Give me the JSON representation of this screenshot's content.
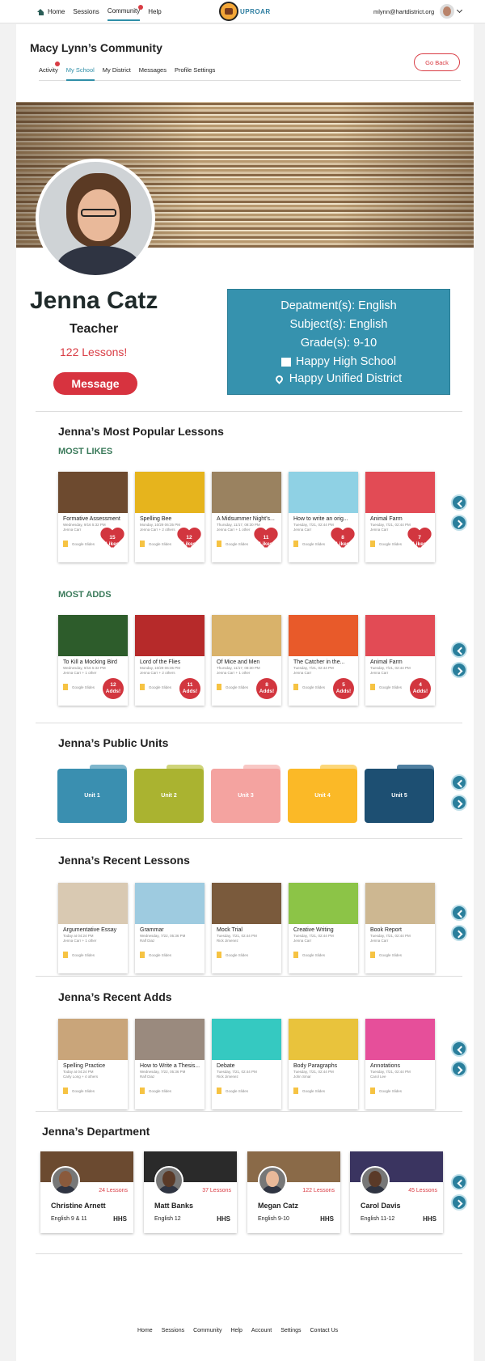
{
  "topnav": {
    "items": [
      "Home",
      "Sessions",
      "Community",
      "Help"
    ],
    "email": "mlynn@hartdistrict.org",
    "logo": "UPROAR"
  },
  "community": {
    "title": "Macy Lynn’s Community",
    "tabs": [
      "Activity",
      "My School",
      "My District",
      "Messages",
      "Profile Settings"
    ],
    "go_back": "Go Back"
  },
  "profile": {
    "name": "Jenna Catz",
    "role": "Teacher",
    "lessons": "122 Lessons!",
    "message_btn": "Message",
    "departments": "Depatment(s): English",
    "subjects": "Subject(s): English",
    "grades": "Grade(s): 9-10",
    "school": "Happy High School",
    "district": "Happy Unified District"
  },
  "popular": {
    "title": "Jenna’s Most Popular Lessons",
    "likes_title": "MOST LIKES",
    "adds_title": "MOST ADDS",
    "likes": [
      {
        "title": "Formative Assessment",
        "meta1": "Wednesday, 9/16 5:32 PM",
        "meta2": "Jenna Carr",
        "source": "Google Slides",
        "badge": "15",
        "badge_word": "Likes",
        "color": "#6d4a2f"
      },
      {
        "title": "Spelling Bee",
        "meta1": "Monday, 10/29 06:35 PM",
        "meta2": "Jenna Carr + 2 others",
        "source": "Google Slides",
        "badge": "12",
        "badge_word": "Likes",
        "color": "#e6b41d"
      },
      {
        "title": "A Midsummer Night’s...",
        "meta1": "Thursday, 11/17, 08:30 PM",
        "meta2": "Jenna Carr + 1 other",
        "source": "Google Slides",
        "badge": "11",
        "badge_word": "Likes",
        "color": "#9a8260"
      },
      {
        "title": "How to write an orig...",
        "meta1": "Tuesday, 7/21, 02:44 PM",
        "meta2": "Jenna Carr",
        "source": "Google Slides",
        "badge": "8",
        "badge_word": "Likes",
        "color": "#8fd1e4"
      },
      {
        "title": "Animal Farm",
        "meta1": "Tuesday, 7/21, 02:44 PM",
        "meta2": "Jenna Carr",
        "source": "Google Slides",
        "badge": "7",
        "badge_word": "Likes",
        "color": "#e24b55"
      }
    ],
    "adds": [
      {
        "title": "To Kill a Mocking Bird",
        "meta1": "Wednesday, 9/16 5:32 PM",
        "meta2": "Jenna Carr + 1 other",
        "source": "Google Slides",
        "badge": "12",
        "badge_word": "Adds!",
        "color": "#2d5c2b"
      },
      {
        "title": "Lord of the Flies",
        "meta1": "Monday, 10/29 06:35 PM",
        "meta2": "Jenna Carr + 2 others",
        "source": "Google Slides",
        "badge": "11",
        "badge_word": "Adds!",
        "color": "#b62a2a"
      },
      {
        "title": "Of Mice and Men",
        "meta1": "Thursday, 11/17, 08:30 PM",
        "meta2": "Jenna Carr + 1 other",
        "source": "Google Slides",
        "badge": "8",
        "badge_word": "Adds!",
        "color": "#d9b26a"
      },
      {
        "title": "The Catcher in the...",
        "meta1": "Tuesday, 7/21, 02:44 PM",
        "meta2": "Jenna Carr",
        "source": "Google Slides",
        "badge": "5",
        "badge_word": "Adds!",
        "color": "#e85a2a"
      },
      {
        "title": "Animal Farm",
        "meta1": "Tuesday, 7/21, 02:44 PM",
        "meta2": "Jenna Carr",
        "source": "Google Slides",
        "badge": "4",
        "badge_word": "Adds!",
        "color": "#e24b55"
      }
    ]
  },
  "units": {
    "title": "Jenna’s Public Units",
    "items": [
      {
        "label": "Unit 1",
        "color": "#3a8fb0",
        "tab": "#7fb6cc"
      },
      {
        "label": "Unit 2",
        "color": "#aab330",
        "tab": "#cfd47a"
      },
      {
        "label": "Unit 3",
        "color": "#f4a3a0",
        "tab": "#f8c8c5"
      },
      {
        "label": "Unit 4",
        "color": "#fbb927",
        "tab": "#fcd77a"
      },
      {
        "label": "Unit 5",
        "color": "#1d4f72",
        "tab": "#4f7fa0"
      }
    ]
  },
  "recent_lessons": {
    "title": "Jenna’s Recent Lessons",
    "items": [
      {
        "title": "Argumentative Essay",
        "meta1": "Today at 04:24 PM",
        "meta2": "Jenna Carr + 1 other",
        "source": "Google Slides",
        "color": "#d9c9b2"
      },
      {
        "title": "Grammar",
        "meta1": "Wednesday, 7/22, 05:36 PM",
        "meta2": "Ralf Diaz",
        "source": "Google Slides",
        "color": "#9ecbe0"
      },
      {
        "title": "Mock Trial",
        "meta1": "Tuesday, 7/21, 02:44 PM",
        "meta2": "Rick Jimenez",
        "source": "Google Slides",
        "color": "#7a5a3c"
      },
      {
        "title": "Creative Writing",
        "meta1": "Tuesday, 7/21, 02:44 PM",
        "meta2": "Jenna Carr",
        "source": "Google Slides",
        "color": "#8cc447"
      },
      {
        "title": "Book Report",
        "meta1": "Tuesday, 7/21, 02:44 PM",
        "meta2": "Jenna Carr",
        "source": "Google Slides",
        "color": "#cdb791"
      }
    ]
  },
  "recent_adds": {
    "title": "Jenna’s Recent Adds",
    "items": [
      {
        "title": "Spelling Practice",
        "meta1": "Today at 04:24 PM",
        "meta2": "Carly Long + 4 others",
        "source": "Google Slides",
        "color": "#c9a57a"
      },
      {
        "title": "How to Write a Thesis...",
        "meta1": "Wednesday, 7/22, 05:36 PM",
        "meta2": "Ralf Diaz",
        "source": "Google Slides",
        "color": "#9a8a7e"
      },
      {
        "title": "Debate",
        "meta1": "Tuesday, 7/21, 02:44 PM",
        "meta2": "Rick Jimenez",
        "source": "Google Slides",
        "color": "#35c9c1"
      },
      {
        "title": "Body Paragraphs",
        "meta1": "Tuesday, 7/21, 02:44 PM",
        "meta2": "John Smar",
        "source": "Google Slides",
        "color": "#e9c33c"
      },
      {
        "title": "Annotations",
        "meta1": "Tuesday, 7/21, 02:44 PM",
        "meta2": "Carol Lee",
        "source": "Google Slides",
        "color": "#e64f9a"
      }
    ]
  },
  "department": {
    "title": "Jenna’s Department",
    "people": [
      {
        "name": "Christine Arnett",
        "lessons": "24 Lessons",
        "classes": "English 9 & 11",
        "school": "HHS",
        "color": "#6b4a30",
        "skin": "#8a5a3c"
      },
      {
        "name": "Matt Banks",
        "lessons": "37 Lessons",
        "classes": "English 12",
        "school": "HHS",
        "color": "#2a2a2a",
        "skin": "#5a3a28"
      },
      {
        "name": "Megan Catz",
        "lessons": "122 Lessons",
        "classes": "English 9-10",
        "school": "HHS",
        "color": "#8a6a48",
        "skin": "#e9b99a"
      },
      {
        "name": "Carol Davis",
        "lessons": "45 Lessons",
        "classes": "English 11-12",
        "school": "HHS",
        "color": "#3a3460",
        "skin": "#5a3a28"
      }
    ]
  },
  "footer": [
    "Home",
    "Sessions",
    "Community",
    "Help",
    "Account",
    "Settings",
    "Contact Us"
  ]
}
